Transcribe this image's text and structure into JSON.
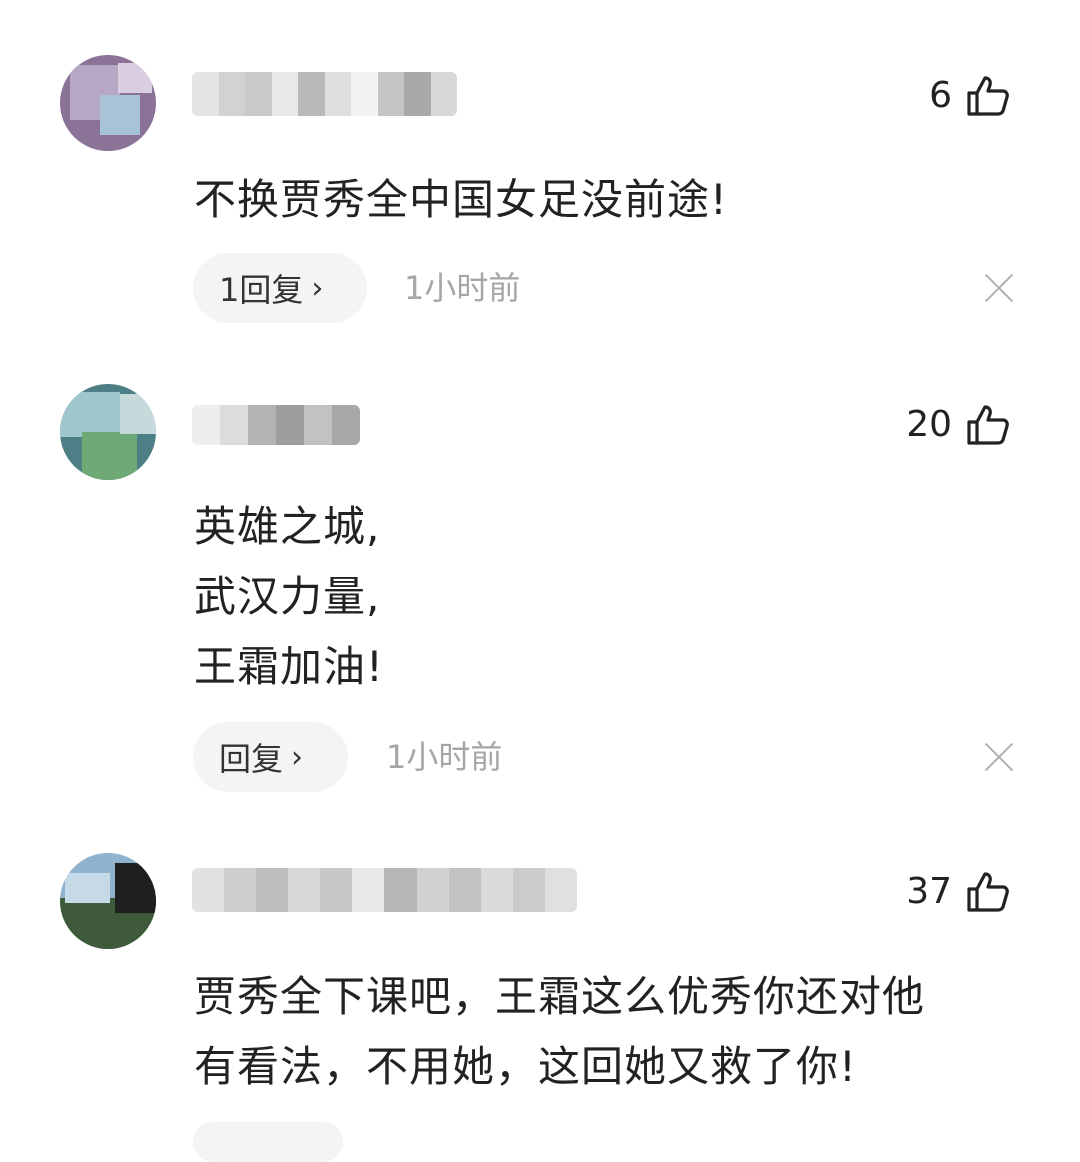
{
  "comments": [
    {
      "likes": "6",
      "text": [
        "不换贾秀全中国女足没前途!"
      ],
      "reply_label": "1回复",
      "time": "1小时前"
    },
    {
      "likes": "20",
      "text": [
        "英雄之城,",
        "武汉力量,",
        "王霜加油!"
      ],
      "reply_label": "回复",
      "time": "1小时前"
    },
    {
      "likes": "37",
      "text": [
        "贾秀全下课吧，王霜这么优秀你还对他",
        "有看法，不用她，这回她又救了你!"
      ]
    }
  ],
  "icons": {
    "like": "thumbs-up-icon",
    "reply_arrow": "chevron-right-icon",
    "dismiss": "close-icon"
  },
  "colors": {
    "text": "#222222",
    "meta": "#a6a6a6",
    "pill_bg": "#f4f4f4",
    "icon_gray": "#b0b0b0"
  }
}
